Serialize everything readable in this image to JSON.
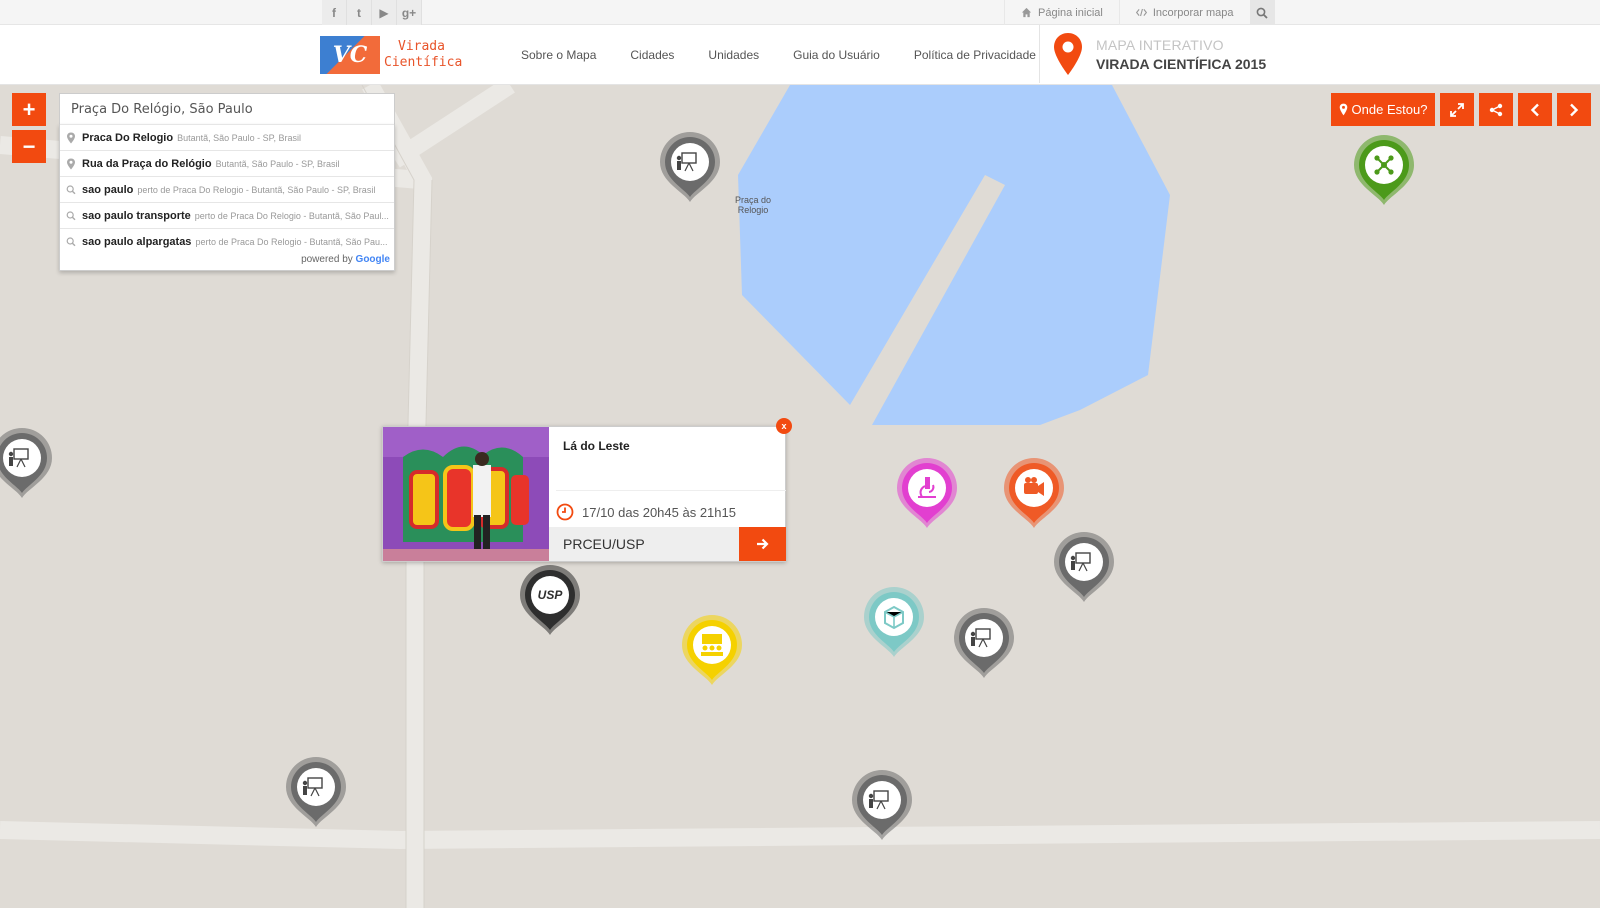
{
  "topbar": {
    "social": [
      {
        "icon": "facebook-icon",
        "glyph": "f"
      },
      {
        "icon": "twitter-icon",
        "glyph": "t"
      },
      {
        "icon": "youtube-icon",
        "glyph": "▶"
      },
      {
        "icon": "google-plus-icon",
        "glyph": "g+"
      }
    ],
    "home_label": "Página inicial",
    "embed_label": "Incorporar mapa"
  },
  "header": {
    "logo_line1": "Virada",
    "logo_line2": "Científica",
    "logo_mark": "VC",
    "nav": [
      "Sobre o Mapa",
      "Cidades",
      "Unidades",
      "Guia do Usuário",
      "Política de Privacidade"
    ],
    "brand_line1": "MAPA INTERATIVO",
    "brand_line2": "VIRADA CIENTÍFICA 2015"
  },
  "map": {
    "zoom_in": "+",
    "zoom_out": "−",
    "search_value": "Praça Do Relógio, São Paulo",
    "place_label_1": "Praça do",
    "place_label_2": "Relogio",
    "suggestions": [
      {
        "type": "place",
        "main": "Praca Do Relogio",
        "sub": "Butantã, São Paulo - SP, Brasil"
      },
      {
        "type": "place",
        "main": "Rua da Praça do Relógio",
        "sub": "Butantã, São Paulo - SP, Brasil"
      },
      {
        "type": "query",
        "main": "sao paulo",
        "sub": "perto de Praca Do Relogio - Butantã, São Paulo - SP, Brasil"
      },
      {
        "type": "query",
        "main": "sao paulo transporte",
        "sub": "perto de Praca Do Relogio - Butantã, São Paul..."
      },
      {
        "type": "query",
        "main": "sao paulo alpargatas",
        "sub": "perto de Praca Do Relogio - Butantã, São Pau..."
      }
    ],
    "powered_by": "powered by",
    "google": "Google",
    "where_am_i": "Onde Estou?",
    "colors": {
      "accent": "#f24a10",
      "water": "#abcdfc",
      "land": "#dfdbd5",
      "road": "#ebe9e5"
    }
  },
  "popup": {
    "title": "Lá do Leste",
    "time": "17/10 das 20h45 às 21h15",
    "unit": "PRCEU/USP",
    "close": "x"
  },
  "markers": [
    {
      "name": "marker-lecture",
      "color": "#6b6b6b",
      "icon": "lecture"
    },
    {
      "name": "marker-lecture",
      "color": "#6b6b6b",
      "icon": "lecture"
    },
    {
      "name": "marker-network",
      "color": "#4c9a1a",
      "icon": "network"
    },
    {
      "name": "marker-science",
      "color": "#e23fd0",
      "icon": "microscope"
    },
    {
      "name": "marker-film",
      "color": "#ef5a26",
      "icon": "camera"
    },
    {
      "name": "marker-lecture",
      "color": "#6b6b6b",
      "icon": "lecture"
    },
    {
      "name": "marker-usp",
      "color": "#2e2e2e",
      "icon": "usp"
    },
    {
      "name": "marker-exhibit",
      "color": "#7dc9c6",
      "icon": "cube"
    },
    {
      "name": "marker-lecture",
      "color": "#6b6b6b",
      "icon": "lecture"
    },
    {
      "name": "marker-audience",
      "color": "#f5d100",
      "icon": "audience"
    },
    {
      "name": "marker-lecture",
      "color": "#6b6b6b",
      "icon": "lecture"
    },
    {
      "name": "marker-lecture",
      "color": "#6b6b6b",
      "icon": "lecture"
    }
  ]
}
